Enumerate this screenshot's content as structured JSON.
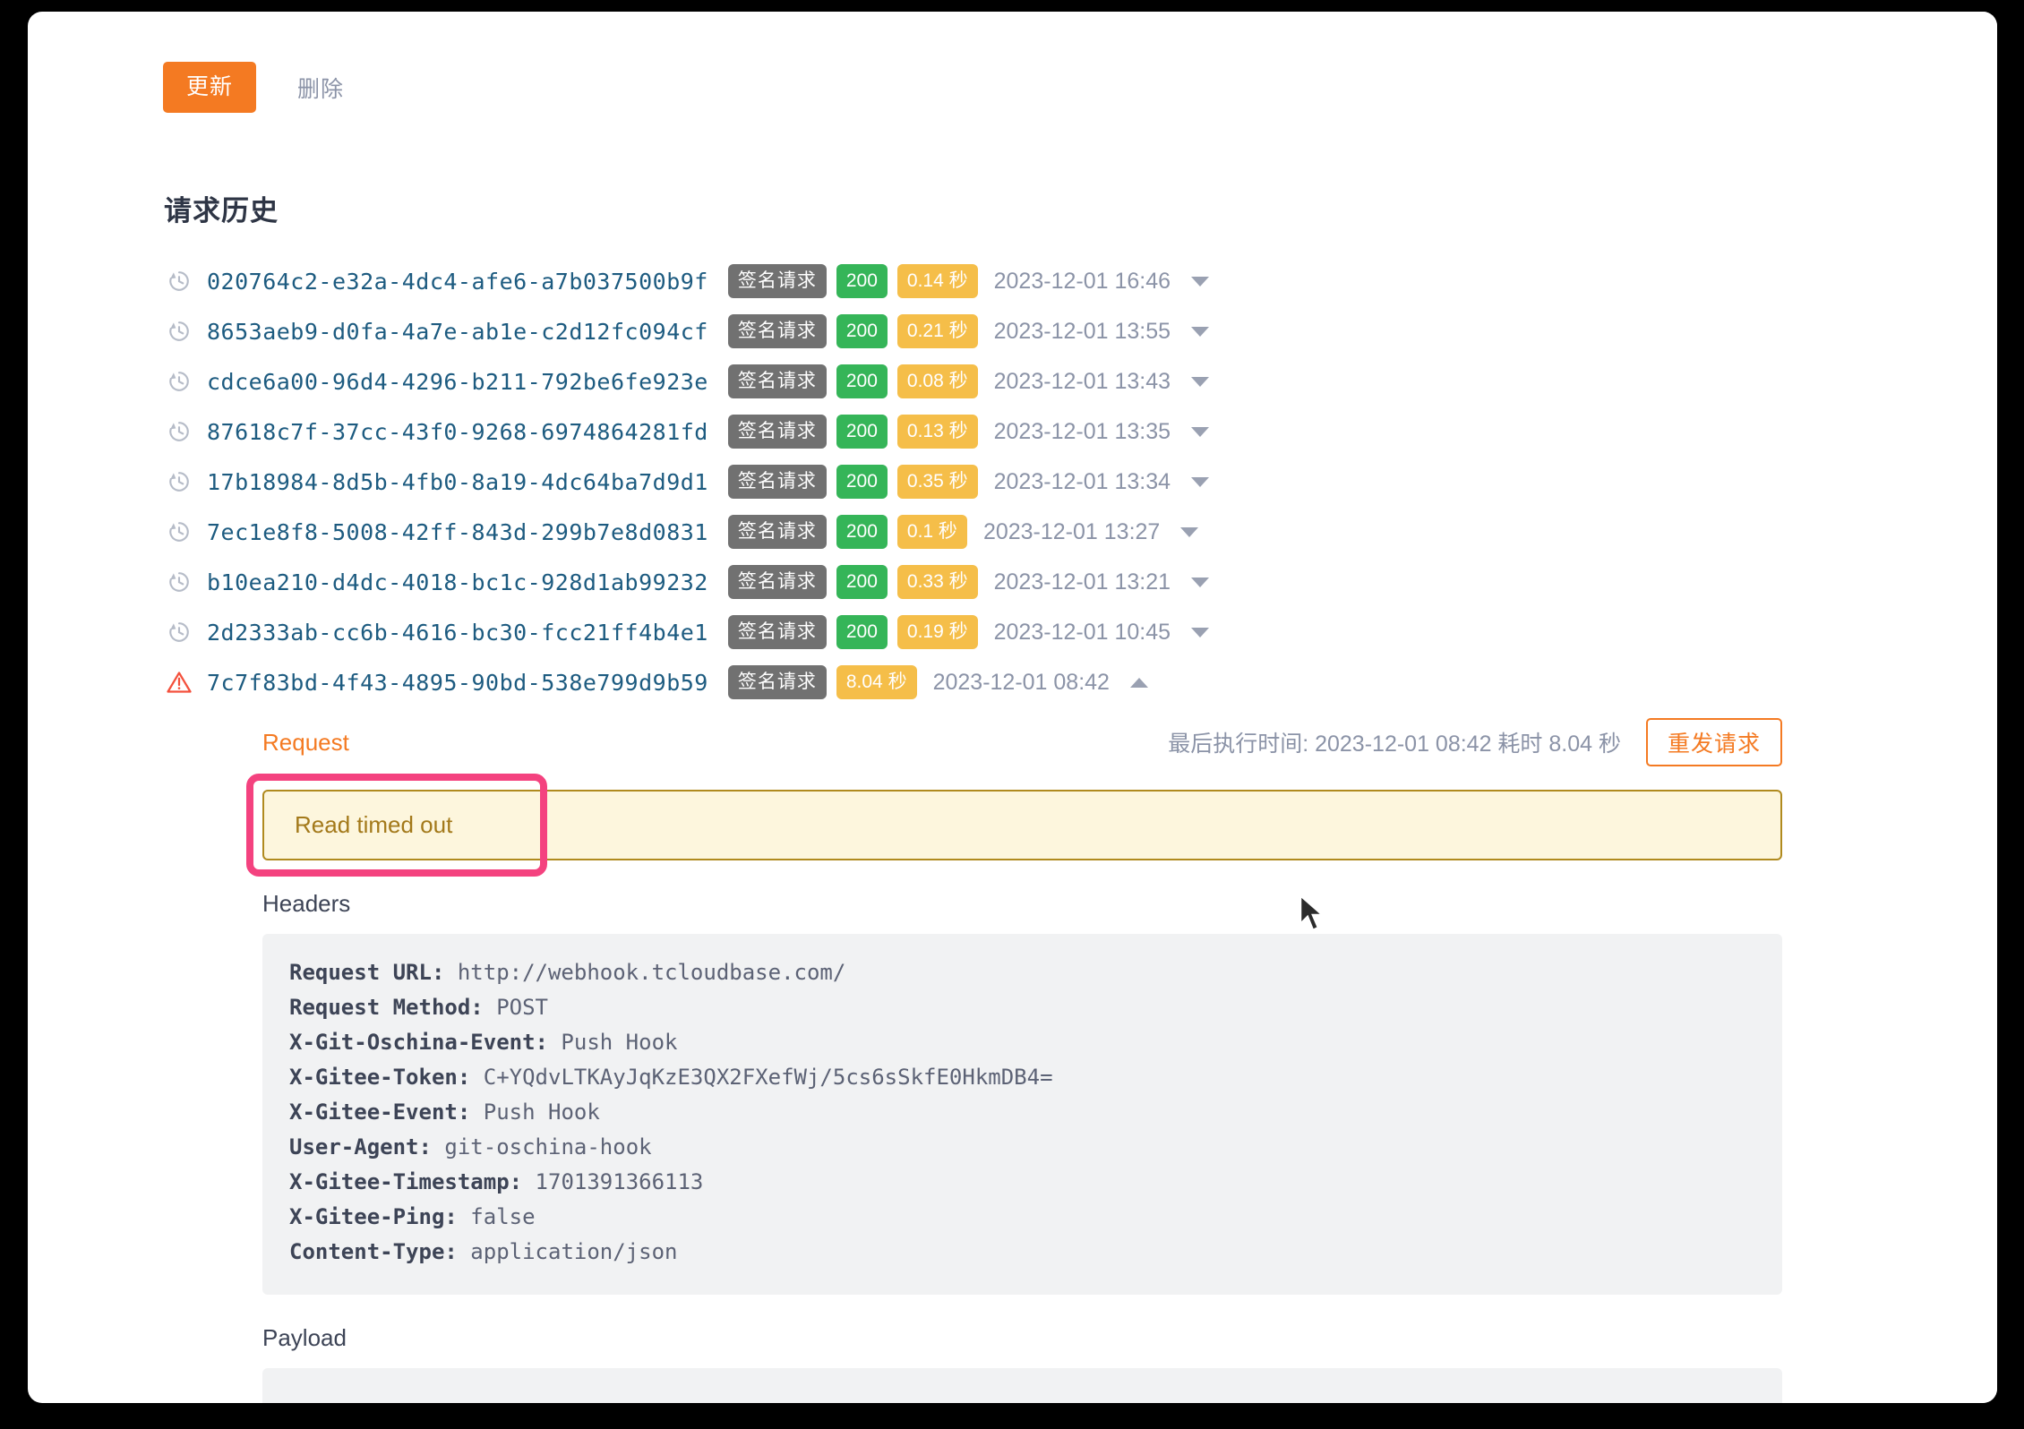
{
  "toolbar": {
    "update_label": "更新",
    "delete_label": "删除",
    "accent_color": "#f47a22"
  },
  "section": {
    "title": "请求历史"
  },
  "history": {
    "badge_type_label": "签名请求",
    "rows": [
      {
        "icon": "history-clock-icon",
        "id": "020764c2-e32a-4dc4-afe6-a7b037500b9f",
        "type": "签名请求",
        "status": "200",
        "duration": "0.14 秒",
        "time": "2023-12-01 16:46",
        "expanded": false
      },
      {
        "icon": "history-clock-icon",
        "id": "8653aeb9-d0fa-4a7e-ab1e-c2d12fc094cf",
        "type": "签名请求",
        "status": "200",
        "duration": "0.21 秒",
        "time": "2023-12-01 13:55",
        "expanded": false
      },
      {
        "icon": "history-clock-icon",
        "id": "cdce6a00-96d4-4296-b211-792be6fe923e",
        "type": "签名请求",
        "status": "200",
        "duration": "0.08 秒",
        "time": "2023-12-01 13:43",
        "expanded": false
      },
      {
        "icon": "history-clock-icon",
        "id": "87618c7f-37cc-43f0-9268-6974864281fd",
        "type": "签名请求",
        "status": "200",
        "duration": "0.13 秒",
        "time": "2023-12-01 13:35",
        "expanded": false
      },
      {
        "icon": "history-clock-icon",
        "id": "17b18984-8d5b-4fb0-8a19-4dc64ba7d9d1",
        "type": "签名请求",
        "status": "200",
        "duration": "0.35 秒",
        "time": "2023-12-01 13:34",
        "expanded": false
      },
      {
        "icon": "history-clock-icon",
        "id": "7ec1e8f8-5008-42ff-843d-299b7e8d0831",
        "type": "签名请求",
        "status": "200",
        "duration": "0.1 秒",
        "time": "2023-12-01 13:27",
        "expanded": false
      },
      {
        "icon": "history-clock-icon",
        "id": "b10ea210-d4dc-4018-bc1c-928d1ab99232",
        "type": "签名请求",
        "status": "200",
        "duration": "0.33 秒",
        "time": "2023-12-01 13:21",
        "expanded": false
      },
      {
        "icon": "history-clock-icon",
        "id": "2d2333ab-cc6b-4616-bc30-fcc21ff4b4e1",
        "type": "签名请求",
        "status": "200",
        "duration": "0.19 秒",
        "time": "2023-12-01 10:45",
        "expanded": false
      },
      {
        "icon": "warning-triangle-icon",
        "id": "7c7f83bd-4f43-4895-90bd-538e799d9b59",
        "type": "签名请求",
        "status": "",
        "duration": "8.04 秒",
        "time": "2023-12-01 08:42",
        "expanded": true
      }
    ]
  },
  "detail": {
    "tab_label": "Request",
    "meta_text": "最后执行时间: 2023-12-01 08:42 耗时 8.04 秒",
    "resend_label": "重发请求",
    "error_message": "Read timed out",
    "headers_label": "Headers",
    "payload_label": "Payload",
    "headers": [
      {
        "key": "Request URL:",
        "value": "http://webhook.tcloudbase.com/"
      },
      {
        "key": "Request Method:",
        "value": "POST"
      },
      {
        "key": "X-Git-Oschina-Event:",
        "value": "Push Hook"
      },
      {
        "key": "X-Gitee-Token:",
        "value": "C+YQdvLTKAyJqKzE3QX2FXefWj/5cs6sSkfE0HkmDB4="
      },
      {
        "key": "X-Gitee-Event:",
        "value": "Push Hook"
      },
      {
        "key": "User-Agent:",
        "value": "git-oschina-hook"
      },
      {
        "key": "X-Gitee-Timestamp:",
        "value": "1701391366113"
      },
      {
        "key": "X-Gitee-Ping:",
        "value": "false"
      },
      {
        "key": "Content-Type:",
        "value": "application/json"
      }
    ]
  },
  "annotation": {
    "highlight_color": "#f4427f",
    "target": "Read timed out"
  },
  "colors": {
    "status_ok": "#35b558",
    "duration": "#f5be49",
    "type_badge": "#717171",
    "alert_bg": "#fdf6dd",
    "alert_border": "#b08a1e",
    "alert_text": "#a3791a",
    "uuid_link": "#1d5b80"
  }
}
